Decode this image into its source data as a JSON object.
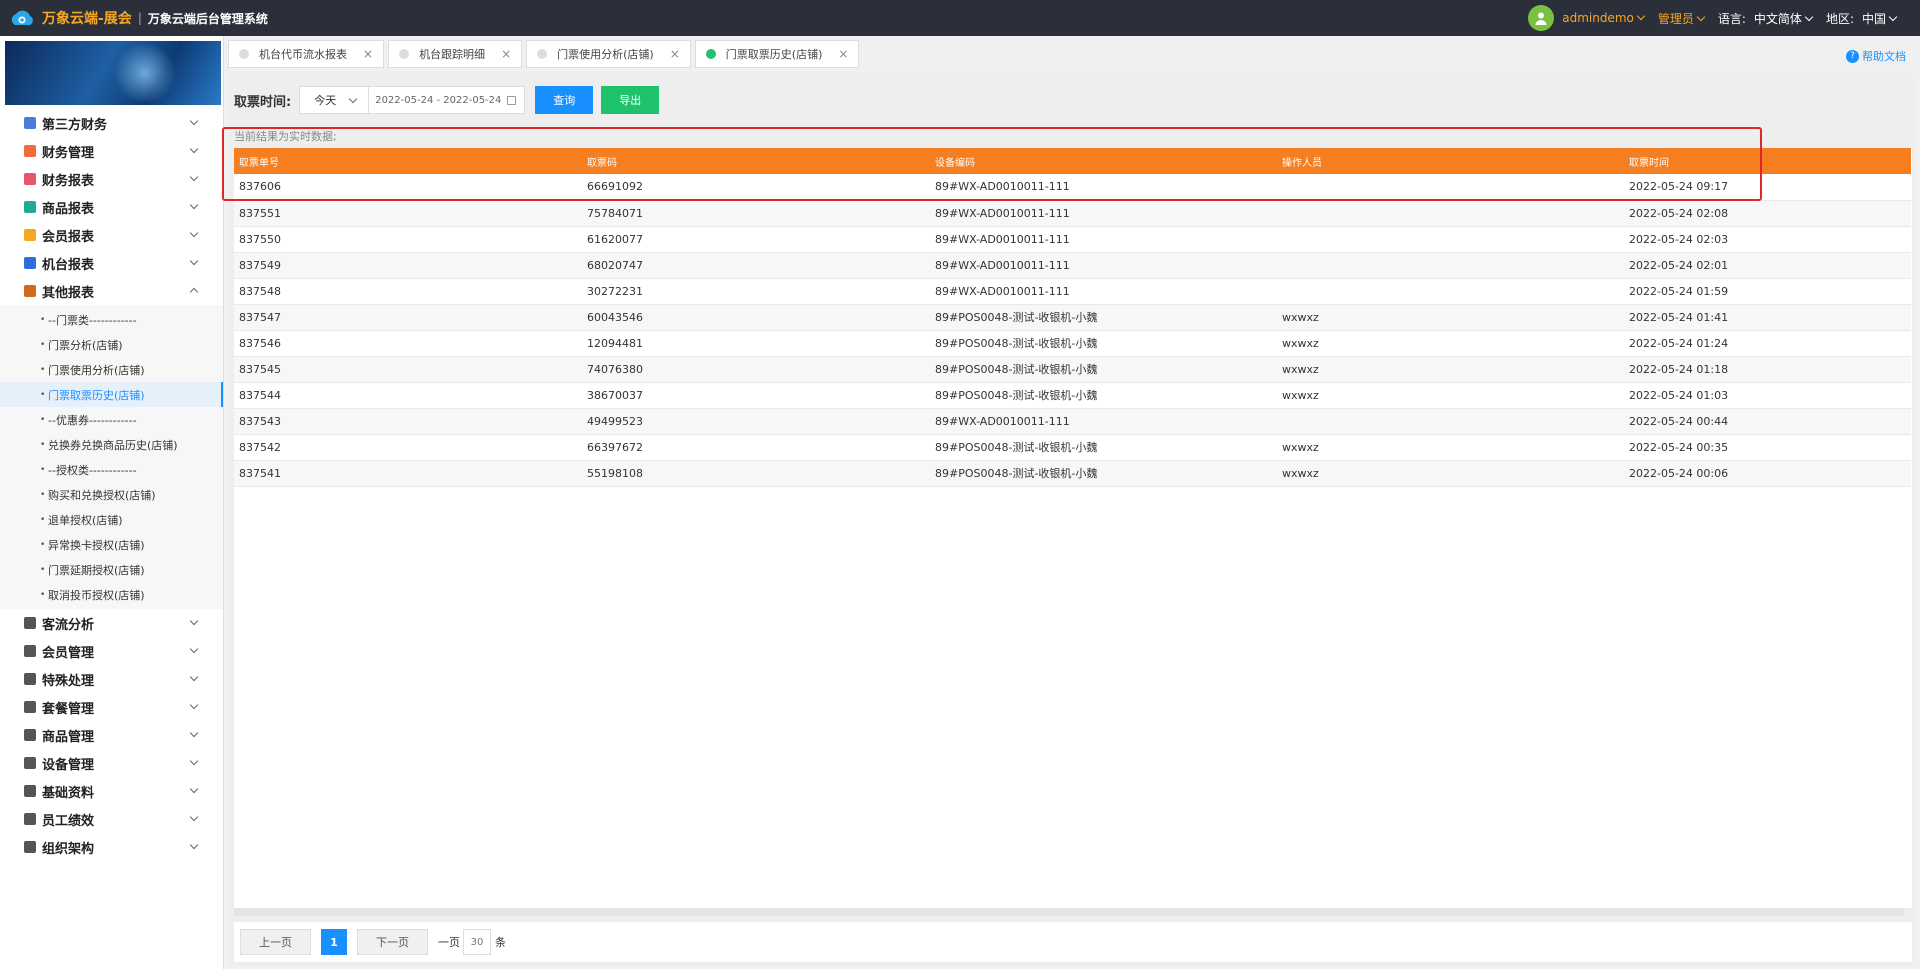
{
  "header": {
    "brand_name": "万象云端-展会",
    "brand_sep": "|",
    "brand_sub": "万象云端后台管理系统",
    "user": "admindemo",
    "role": "管理员",
    "lang_label": "语言:",
    "lang_value": "中文简体",
    "region_label": "地区:",
    "region_value": "中国"
  },
  "sidebar": {
    "menu_top": [
      {
        "label": "第三方财务",
        "color": "#4a7bd9"
      },
      {
        "label": "财务管理",
        "color": "#f26b3a"
      },
      {
        "label": "财务报表",
        "color": "#e8546a"
      },
      {
        "label": "商品报表",
        "color": "#22aa99"
      },
      {
        "label": "会员报表",
        "color": "#f5a623"
      },
      {
        "label": "机台报表",
        "color": "#2a6fdb"
      },
      {
        "label": "其他报表",
        "color": "#d2691e"
      }
    ],
    "sub_items": [
      "--门票类------------",
      "门票分析(店铺)",
      "门票使用分析(店铺)",
      "门票取票历史(店铺)",
      "--优惠券------------",
      "兑换券兑换商品历史(店铺)",
      "--授权类------------",
      "购买和兑换授权(店铺)",
      "退单授权(店铺)",
      "异常换卡授权(店铺)",
      "门票延期授权(店铺)",
      "取消投币授权(店铺)"
    ],
    "menu_bottom": [
      {
        "label": "客流分析",
        "color": "#555"
      },
      {
        "label": "会员管理",
        "color": "#555"
      },
      {
        "label": "特殊处理",
        "color": "#555"
      },
      {
        "label": "套餐管理",
        "color": "#555"
      },
      {
        "label": "商品管理",
        "color": "#555"
      },
      {
        "label": "设备管理",
        "color": "#555"
      },
      {
        "label": "基础资料",
        "color": "#555"
      },
      {
        "label": "员工绩效",
        "color": "#555"
      },
      {
        "label": "组织架构",
        "color": "#555"
      }
    ]
  },
  "tabs": [
    {
      "label": "机台代币流水报表",
      "close": "×"
    },
    {
      "label": "机台跟踪明细",
      "close": "×"
    },
    {
      "label": "门票使用分析(店铺)",
      "close": "×"
    },
    {
      "label": "门票取票历史(店铺)",
      "close": "×"
    }
  ],
  "help": {
    "label": "帮助文档",
    "icon": "?"
  },
  "filters": {
    "label": "取票时间:",
    "period": "今天",
    "date_range": "2022-05-24 - 2022-05-24",
    "query": "查询",
    "export": "导出"
  },
  "notice": "当前结果为实时数据;",
  "table": {
    "columns": [
      "取票单号",
      "取票码",
      "设备编码",
      "操作人员",
      "取票时间"
    ],
    "rows": [
      [
        "837606",
        "66691092",
        "89#WX-AD0010011-111",
        "",
        "2022-05-24 09:17"
      ],
      [
        "837551",
        "75784071",
        "89#WX-AD0010011-111",
        "",
        "2022-05-24 02:08"
      ],
      [
        "837550",
        "61620077",
        "89#WX-AD0010011-111",
        "",
        "2022-05-24 02:03"
      ],
      [
        "837549",
        "68020747",
        "89#WX-AD0010011-111",
        "",
        "2022-05-24 02:01"
      ],
      [
        "837548",
        "30272231",
        "89#WX-AD0010011-111",
        "",
        "2022-05-24 01:59"
      ],
      [
        "837547",
        "60043546",
        "89#POS0048-测试-收银机-小魏",
        "wxwxz",
        "2022-05-24 01:41"
      ],
      [
        "837546",
        "12094481",
        "89#POS0048-测试-收银机-小魏",
        "wxwxz",
        "2022-05-24 01:24"
      ],
      [
        "837545",
        "74076380",
        "89#POS0048-测试-收银机-小魏",
        "wxwxz",
        "2022-05-24 01:18"
      ],
      [
        "837544",
        "38670037",
        "89#POS0048-测试-收银机-小魏",
        "wxwxz",
        "2022-05-24 01:03"
      ],
      [
        "837543",
        "49499523",
        "89#WX-AD0010011-111",
        "",
        "2022-05-24 00:44"
      ],
      [
        "837542",
        "66397672",
        "89#POS0048-测试-收银机-小魏",
        "wxwxz",
        "2022-05-24 00:35"
      ],
      [
        "837541",
        "55198108",
        "89#POS0048-测试-收银机-小魏",
        "wxwxz",
        "2022-05-24 00:06"
      ]
    ]
  },
  "pager": {
    "prev": "上一页",
    "current": "1",
    "next": "下一页",
    "size_label": "一页",
    "size": "30",
    "size_unit": "条"
  }
}
